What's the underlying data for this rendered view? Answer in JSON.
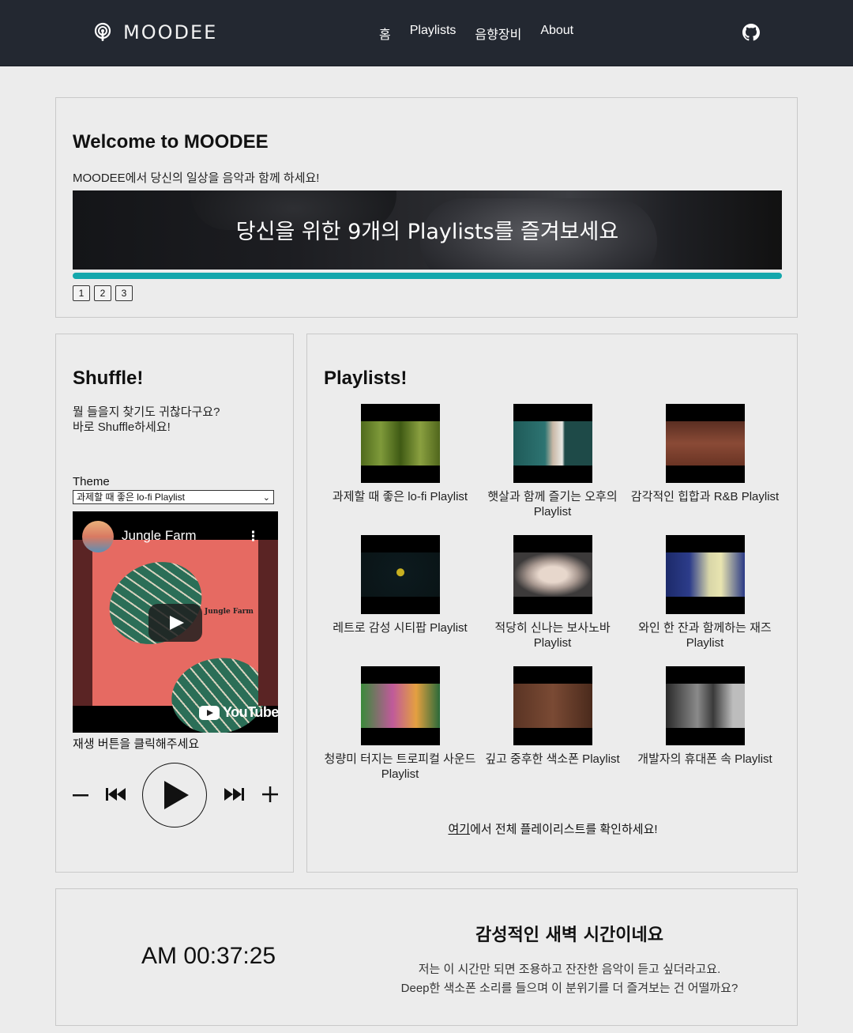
{
  "header": {
    "logo_text": "MOODEE",
    "nav": [
      "홈",
      "Playlists",
      "음향장비",
      "About"
    ],
    "github_icon": "github-icon"
  },
  "welcome": {
    "title": "Welcome to MOODEE",
    "subtitle": "MOODEE에서 당신의 일상을 음악과 함께 하세요!",
    "banner_text": "당신을 위한 9개의 Playlists를 즐겨보세요",
    "pages": [
      "1",
      "2",
      "3"
    ],
    "accent_color": "#14a7ac"
  },
  "shuffle": {
    "title": "Shuffle!",
    "desc_line1": "뭘 들을지 찾기도 귀찮다구요?",
    "desc_line2": "바로 Shuffle하세요!",
    "theme_label": "Theme",
    "theme_selected": "과제할 때 좋은 lo-fi Playlist",
    "video_title": "Jungle Farm",
    "video_art_text": "Jungle Farm",
    "youtube_text": "YouTube",
    "hint": "재생 버튼을 클릭해주세요"
  },
  "playlists": {
    "title": "Playlists!",
    "items": [
      {
        "label": "과제할 때 좋은 lo-fi Playlist"
      },
      {
        "label": "햇살과 함께 즐기는 오후의 Playlist"
      },
      {
        "label": "감각적인 힙합과 R&B Playlist"
      },
      {
        "label": "레트로 감성 시티팝 Playlist"
      },
      {
        "label": "적당히 신나는 보사노바 Playlist"
      },
      {
        "label": "와인 한 잔과 함께하는 재즈 Playlist"
      },
      {
        "label": "청량미 터지는 트로피컬 사운드 Playlist"
      },
      {
        "label": "깊고 중후한 색소폰 Playlist"
      },
      {
        "label": "개발자의 휴대폰 속 Playlist"
      }
    ],
    "footer_link": "여기",
    "footer_text": "에서 전체 플레이리스트를 확인하세요!"
  },
  "clock": {
    "time": "AM 00:37:25",
    "heading": "감성적인 새벽 시간이네요",
    "msg_line1": "저는 이 시간만 되면 조용하고 잔잔한 음악이 듣고 싶더라고요.",
    "msg_line2": "Deep한 색소폰 소리를 들으며 이 분위기를 더 즐겨보는 건 어떨까요?"
  }
}
